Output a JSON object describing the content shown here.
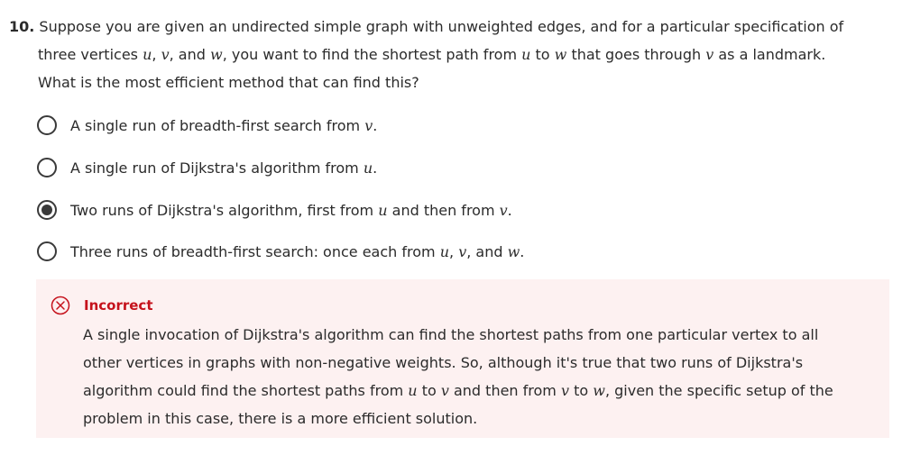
{
  "question": {
    "number": "10.",
    "line1": " Suppose you are given an undirected simple graph with unweighted edges, and  for a particular specification of",
    "line2_a": "three vertices ",
    "line2_u": "u",
    "line2_b": ", ",
    "line2_v": "v",
    "line2_c": ", and ",
    "line2_w": "w",
    "line2_d": ", you want to find the shortest path from ",
    "line2_u2": "u",
    "line2_e": " to ",
    "line2_w2": "w",
    "line2_f": " that goes through ",
    "line2_v2": "v",
    "line2_g": " as a landmark.",
    "line3": "What is the most efficient method that can find this?"
  },
  "options": [
    {
      "text_a": "A single run of breadth-first search from ",
      "var1": "v",
      "text_b": "."
    },
    {
      "text_a": "A single run of Dijkstra's algorithm from ",
      "var1": "u",
      "text_b": "."
    },
    {
      "text_a": "Two runs of Dijkstra's algorithm, first from ",
      "var1": "u",
      "text_b": " and then from ",
      "var2": "v",
      "text_c": "."
    },
    {
      "text_a": "Three runs of breadth-first search: once each from ",
      "var1": "u",
      "text_b": ", ",
      "var2": "v",
      "text_c": ", and ",
      "var3": "w",
      "text_d": "."
    }
  ],
  "selected_option": 2,
  "feedback": {
    "status": "Incorrect",
    "icon": "x-circle-icon",
    "line1": "A single invocation of Dijkstra's algorithm can find the shortest paths from one particular vertex to all",
    "line2": "other vertices in graphs with non-negative weights. So, although it's true that two runs of Dijkstra's",
    "line3_a": "algorithm could find the shortest paths from ",
    "line3_u": "u",
    "line3_b": " to ",
    "line3_v": "v",
    "line3_c": " and then from ",
    "line3_v2": "v",
    "line3_d": " to ",
    "line3_w": "w",
    "line3_e": ", given the specific setup of the",
    "line4": "problem in this case, there is a more efficient solution."
  },
  "colors": {
    "error": "#c5121c",
    "feedback_bg": "#fdf1f1",
    "text": "#2b2b2b"
  }
}
